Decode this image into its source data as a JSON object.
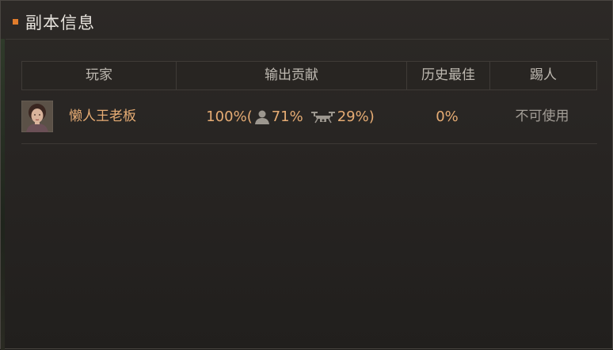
{
  "panel": {
    "title": "副本信息"
  },
  "table": {
    "headers": {
      "player": "玩家",
      "output": "输出贡献",
      "best": "历史最佳",
      "kick": "踢人"
    },
    "rows": [
      {
        "player_name": "懒人王老板",
        "output_total": "100%(",
        "output_player": "71%",
        "output_pet": "29%)",
        "best": "0%",
        "kick": "不可使用"
      }
    ]
  },
  "colors": {
    "accent": "#e07c2c",
    "value_text": "#e6ac74",
    "header_text": "#bdb8b0",
    "disabled_text": "#a29d96"
  },
  "icons": {
    "player_share": "person-icon",
    "pet_share": "drone-icon"
  }
}
